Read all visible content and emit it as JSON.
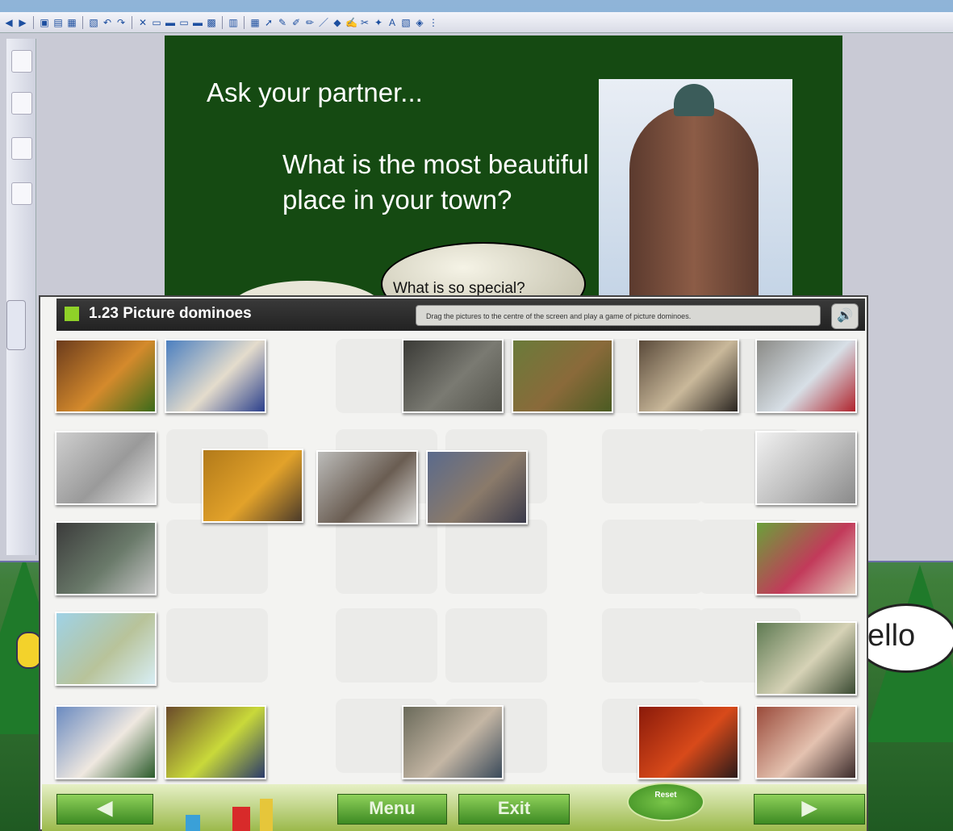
{
  "slide": {
    "heading": "Ask your partner...",
    "question": "What is the most beautiful place in your town?",
    "speech_bubble": "What is so special?"
  },
  "background": {
    "speech_bubble_text": "ello"
  },
  "activity": {
    "title": "1.23 Picture dominoes",
    "instructions": "Drag the pictures to the centre of the screen and play a game of picture dominoes.",
    "audio_icon": "speaker-icon",
    "reset_label": "Reset",
    "menu_label": "Menu",
    "exit_label": "Exit",
    "prev_icon": "left-arrow-icon",
    "next_icon": "right-arrow-icon"
  },
  "tiles": [
    {
      "name": "burger",
      "colors": [
        "#6b3b1c",
        "#d48a2c",
        "#3b6b1a"
      ]
    },
    {
      "name": "beach",
      "colors": [
        "#4b7fc0",
        "#e4dccc",
        "#2a3f8c"
      ]
    },
    {
      "name": "city",
      "colors": [
        "#3a3a36",
        "#7a7a72",
        "#55554d"
      ]
    },
    {
      "name": "elephants",
      "colors": [
        "#6a7b3a",
        "#8a6a3a",
        "#4a5b22"
      ]
    },
    {
      "name": "food-market",
      "colors": [
        "#5a4a3a",
        "#c9b89a",
        "#2a2520"
      ]
    },
    {
      "name": "snowy-walk",
      "colors": [
        "#8a8a86",
        "#d7dfe6",
        "#b0232c"
      ]
    },
    {
      "name": "blueprint",
      "colors": [
        "#cfcfcf",
        "#9a9a9a",
        "#e8e8e8"
      ]
    },
    {
      "name": "taxis",
      "colors": [
        "#b27a1a",
        "#e2a22a",
        "#4a3a2a"
      ]
    },
    {
      "name": "phone",
      "colors": [
        "#bcbcba",
        "#6a5d52",
        "#e0e0de"
      ]
    },
    {
      "name": "children",
      "colors": [
        "#5a6a8c",
        "#8a7a6a",
        "#3a3a4a"
      ]
    },
    {
      "name": "faucet",
      "colors": [
        "#f1f1f1",
        "#bcbcbc",
        "#8a8a8a"
      ]
    },
    {
      "name": "bus",
      "colors": [
        "#3b3b3b",
        "#6a7a6a",
        "#c6c6c6"
      ]
    },
    {
      "name": "couple",
      "colors": [
        "#6aa13a",
        "#c23a5a",
        "#e3d0c0"
      ]
    },
    {
      "name": "world-map",
      "colors": [
        "#9fd2e6",
        "#b8c39a",
        "#d8eef5"
      ]
    },
    {
      "name": "money",
      "colors": [
        "#5e7a52",
        "#d6d2b6",
        "#3a4a32"
      ]
    },
    {
      "name": "taj-mahal",
      "colors": [
        "#6a8ac0",
        "#efe8e0",
        "#2a5a2a"
      ]
    },
    {
      "name": "tennis-ball",
      "colors": [
        "#6a4a2a",
        "#c9d93a",
        "#2a3a6a"
      ]
    },
    {
      "name": "shop",
      "colors": [
        "#6a6a5a",
        "#c4b6a4",
        "#3a4a5a"
      ]
    },
    {
      "name": "train",
      "colors": [
        "#8a1a0a",
        "#d84a1a",
        "#2a1a1a"
      ]
    },
    {
      "name": "family",
      "colors": [
        "#9a4a3a",
        "#e4c2b0",
        "#3a2a2a"
      ]
    }
  ],
  "toolbar_icons": [
    "back-arrow-icon",
    "forward-arrow-icon",
    "page-icon",
    "open-icon",
    "save-icon",
    "new-page-icon",
    "undo-icon",
    "redo-icon",
    "delete-icon",
    "display-icon",
    "display-2-icon",
    "display-3-icon",
    "display-4-icon",
    "screen-capture-icon",
    "text-icon",
    "table-icon",
    "select-icon",
    "pen-icon",
    "brush-icon",
    "highlighter-icon",
    "line-icon",
    "fill-icon",
    "magic-pen-icon",
    "eraser-icon",
    "recognize-icon",
    "font-icon",
    "insert-icon",
    "shape-icon",
    "more-icon"
  ]
}
